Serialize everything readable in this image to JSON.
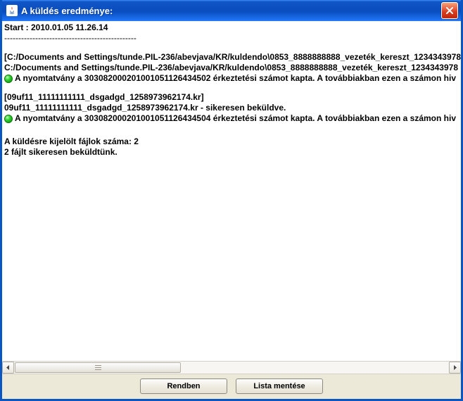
{
  "window": {
    "title": "A küldés eredménye:"
  },
  "content": {
    "start_line": "Start : 2010.01.05 11.26.14",
    "divider": "-----------------------------------------------",
    "file1_br": "[C:/Documents and Settings/tunde.PIL-236/abevjava/KR/kuldendo\\0853_8888888888_vezeték_kereszt_1234343978",
    "file1_pl": "C:/Documents and Settings/tunde.PIL-236/abevjava/KR/kuldendo\\0853_8888888888_vezeték_kereszt_1234343978",
    "ack1": "A nyomtatvány a 303082000201001051126434502 érkeztetési számot kapta. A továbbiakban ezen a számon hiv",
    "file2_br": "[09uf11_11111111111_dsgadgd_1258973962174.kr]",
    "file2_pl": "09uf11_11111111111_dsgadgd_1258973962174.kr  - sikeresen beküldve.",
    "ack2": "A nyomtatvány a 303082000201001051126434504 érkeztetési számot kapta. A továbbiakban ezen a számon hiv",
    "summary1": "A küldésre kijelölt fájlok száma: 2",
    "summary2": "2 fájlt sikeresen beküldtünk."
  },
  "buttons": {
    "ok": "Rendben",
    "save_list": "Lista mentése"
  }
}
